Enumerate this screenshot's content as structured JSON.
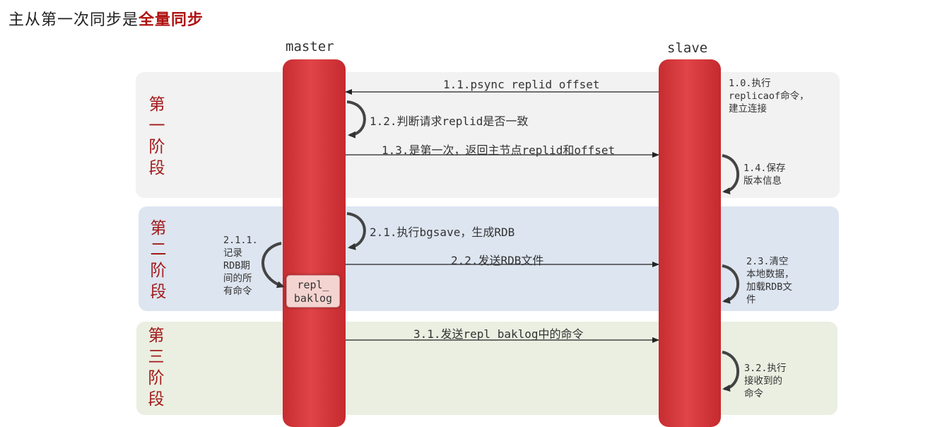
{
  "title": {
    "prefix": "主从第一次同步是",
    "highlight": "全量同步"
  },
  "columns": {
    "master": "master",
    "slave": "slave"
  },
  "stages": [
    {
      "chars": [
        "第",
        "一",
        "阶",
        "段"
      ]
    },
    {
      "chars": [
        "第",
        "二",
        "阶",
        "段"
      ]
    },
    {
      "chars": [
        "第",
        "三",
        "阶",
        "段"
      ]
    }
  ],
  "messages": {
    "m1_1": "1.1.psync replid offset",
    "m1_2": "1.2.判断请求replid是否一致",
    "m1_3": "1.3.是第一次，返回主节点replid和offset",
    "m2_1": "2.1.执行bgsave，生成RDB",
    "m2_2": "2.2.发送RDB文件",
    "m3_1": "3.1.发送repl_baklog中的命令"
  },
  "notes": {
    "n1_0": "1.0.执行\nreplicaof命令，\n建立连接",
    "n1_4": "1.4.保存\n版本信息",
    "n2_1_1": "2.1.1.\n记录\nRDB期\n间的所\n有命令",
    "n2_3": "2.3.清空\n本地数据，\n加载RDB文\n件",
    "n3_2": "3.2.执行\n接收到的\n命令"
  },
  "repl_box": "repl_\nbaklog",
  "colors": {
    "accent": "#b01010",
    "bar": "#d93a3e"
  }
}
